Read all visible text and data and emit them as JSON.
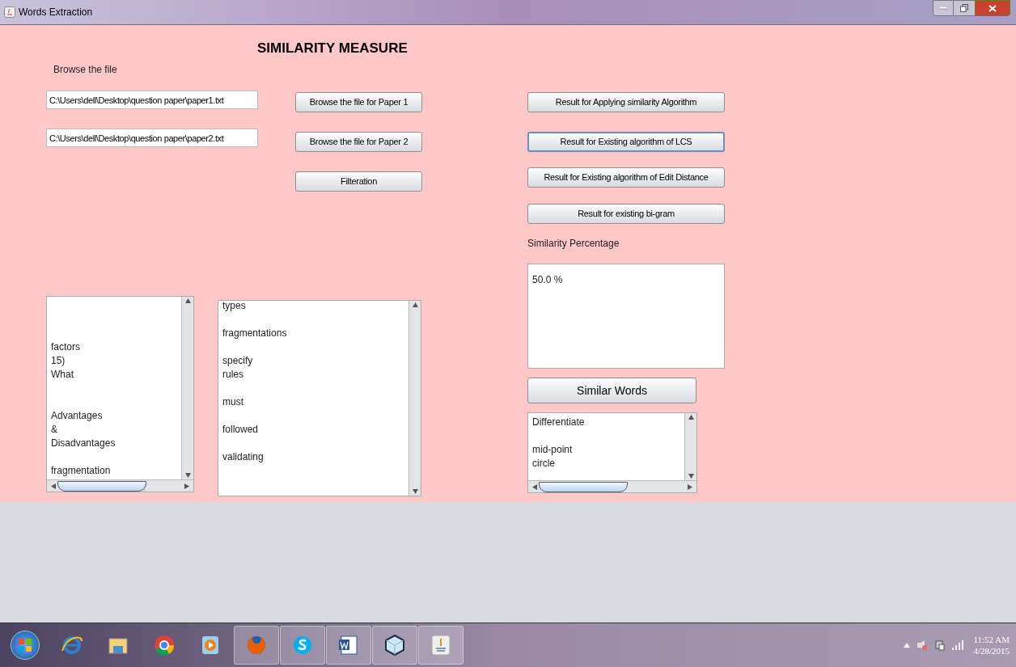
{
  "window": {
    "title": "Words Extraction"
  },
  "heading": "SIMILARITY MEASURE",
  "browse_label": "Browse the file",
  "file_fields": [
    {
      "value": "C:\\Users\\dell\\Desktop\\question paper\\paper1.txt"
    },
    {
      "value": "C:\\Users\\dell\\Desktop\\question paper\\paper2.txt"
    }
  ],
  "middle_buttons": [
    {
      "label": "Browse the file for Paper 1",
      "focused": false
    },
    {
      "label": "Browse the file for  Paper 2",
      "focused": false
    },
    {
      "label": "Filteration",
      "focused": false
    }
  ],
  "result_buttons": [
    {
      "label": "Result for Applying similarity Algorithm",
      "focused": false
    },
    {
      "label": "Result for Existing algorithm of LCS",
      "focused": true
    },
    {
      "label": "Result for Existing algorithm of Edit Distance",
      "focused": false
    },
    {
      "label": "Result for existing  bi-gram",
      "focused": false
    }
  ],
  "similarity_label": "Similarity Percentage",
  "similarity_value": "50.0 %",
  "similar_words_button": {
    "label": "Similar Words",
    "focused": false
  },
  "word_lists": [
    {
      "text": "\n\n\nfactors\n15)\nWhat\n\n\nAdvantages\n&\nDisadvantages\n\nfragmentation"
    },
    {
      "text": "types\n\nfragmentations\n\nspecify\nrules\n\nmust\n\nfollowed\n\nvalidating"
    },
    {
      "text": "Differentiate\n\nmid-point\ncircle"
    }
  ],
  "taskbar": {
    "items": [
      {
        "kind": "ie",
        "running": false
      },
      {
        "kind": "folder",
        "running": false
      },
      {
        "kind": "chrome",
        "running": false
      },
      {
        "kind": "player",
        "running": false
      },
      {
        "kind": "firefox",
        "running": true
      },
      {
        "kind": "skype",
        "running": true
      },
      {
        "kind": "word",
        "running": true
      },
      {
        "kind": "cube",
        "running": true
      },
      {
        "kind": "java",
        "running": true
      }
    ],
    "clock_time": "11:52 AM",
    "clock_date": "4/28/2015"
  }
}
